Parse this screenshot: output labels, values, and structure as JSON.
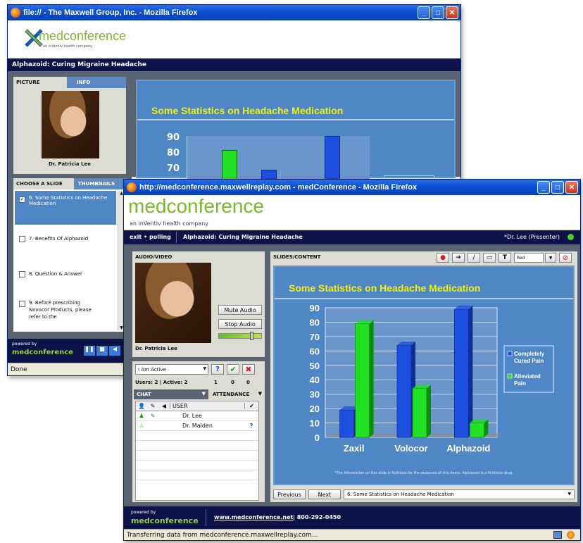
{
  "back_window": {
    "title": "file:// - The Maxwell Group, Inc. - Mozilla Firefox",
    "logo_main": "medconference",
    "logo_sub": "an inVentiv health company",
    "session_title": "Alphazoid: Curing Migraine Headache",
    "tab_picture": "PICTURE",
    "tab_info": "INFO",
    "presenter_name": "Dr. Patricia Lee",
    "tab_choose_slide": "CHOOSE A SLIDE",
    "tab_thumbnails": "THUMBNAILS",
    "slides": [
      {
        "label": "6. Some Statistics on Headache Medication",
        "checked": true
      },
      {
        "label": "7. Benefits Of Alphazoid",
        "checked": false
      },
      {
        "label": "8. Question & Answer",
        "checked": false
      },
      {
        "label": "9. Before prescribing Novocor Products, please refer to the",
        "checked": false
      }
    ],
    "slide_title": "Some Statistics on Headache Medication",
    "powered_by": "powered by",
    "powered_brand": "medconference",
    "status": "Done",
    "axis_ticks": [
      "90",
      "80",
      "70"
    ]
  },
  "front_window": {
    "title": "http://medconference.maxwellreplay.com - medConference - Mozilla Firefox",
    "logo_main": "medconference",
    "logo_sub": "an inVentiv health company",
    "nav_exit": "exit",
    "nav_polling": "polling",
    "session_title": "Alphazoid: Curing Migraine Headache",
    "presenter": "*Dr. Lee (Presenter)",
    "audio_video_label": "AUDIO/VIDEO",
    "mute_audio": "Mute Audio",
    "stop_audio": "Stop Audio",
    "presenter_name": "Dr. Patricia Lee",
    "status_select": "I Am Active",
    "users_text": "Users: 2 | Active: 2",
    "count_1": "1",
    "count_2": "0",
    "count_3": "0",
    "chat_label": "CHAT",
    "attendance_label": "ATTENDANCE",
    "user_col": "USER",
    "users": [
      {
        "name": "Dr. Lee",
        "status": ""
      },
      {
        "name": "Dr. Maiden",
        "status": "?"
      }
    ],
    "slides_label": "SLIDES/CONTENT",
    "pen_color": "Red",
    "tool_text": "T",
    "previous": "Previous",
    "next": "Next",
    "current_slide": "6. Some Statistics on Headache Medication",
    "footnote": "*The information on this slide is fictitious for the purposes of this demo.  Alphazoid is a fictitious drug.",
    "powered_by": "powered by",
    "powered_brand": "medconference",
    "footer_link": "www.medconference.net",
    "footer_phone": "| 800-292-0450",
    "status": "Transferring data from medconference.maxwellreplay.com..."
  },
  "colors": {
    "series_blue": "#1f4fe0",
    "series_green": "#22e022",
    "slide_bg": "#4f86c6",
    "title_yellow": "#f2f200",
    "navy": "#0d1248"
  },
  "chart_data": {
    "type": "bar",
    "title": "Some Statistics on Headache Medication",
    "categories": [
      "Zaxil",
      "Volocor",
      "Alphazoid"
    ],
    "series": [
      {
        "name": "Completely Cured Pain",
        "values": [
          19,
          64,
          89
        ]
      },
      {
        "name": "Alleviated Pain",
        "values": [
          79,
          34,
          10
        ]
      }
    ],
    "yticks": [
      "0",
      "10",
      "20",
      "30",
      "40",
      "50",
      "60",
      "70",
      "80",
      "90"
    ],
    "ylim": [
      0,
      90
    ],
    "legend_position": "right",
    "grid": true
  }
}
